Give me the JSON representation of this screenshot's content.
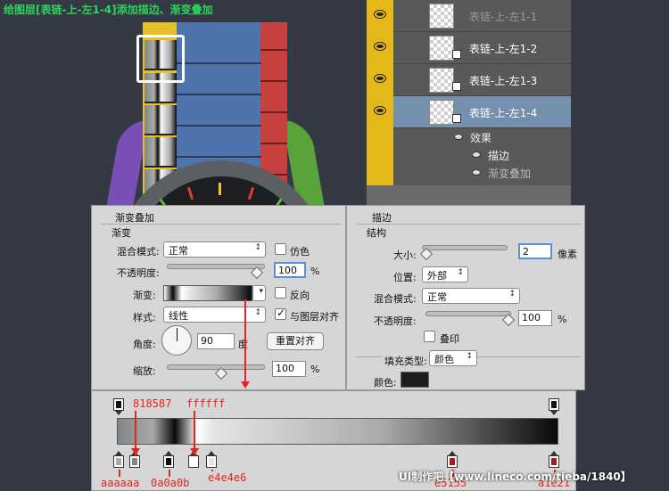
{
  "caption": "给图层[表链-上-左1-4]添加描边、渐变叠加",
  "layers": [
    {
      "name": "表链-上-左1-1",
      "selected": false,
      "dim": true
    },
    {
      "name": "表链-上-左1-2",
      "selected": false,
      "dim": false
    },
    {
      "name": "表链-上-左1-3",
      "selected": false,
      "dim": false
    },
    {
      "name": "表链-上-左1-4",
      "selected": true,
      "dim": false
    }
  ],
  "effects": {
    "header": "效果",
    "stroke": "描边",
    "gradient_overlay": "渐变叠加"
  },
  "gradient_dialog": {
    "title": "渐变叠加",
    "group": "渐变",
    "blend_mode_label": "混合模式:",
    "blend_mode_value": "正常",
    "dither_label": "仿色",
    "opacity_label": "不透明度:",
    "opacity_value": "100",
    "percent": "%",
    "gradient_label": "渐变:",
    "reverse_label": "反向",
    "style_label": "样式:",
    "style_value": "线性",
    "align_label": "与图层对齐",
    "angle_label": "角度:",
    "angle_value": "90",
    "degree": "度",
    "reset_button": "重置对齐",
    "scale_label": "缩放:",
    "scale_value": "100"
  },
  "stroke_dialog": {
    "title": "描边",
    "group": "结构",
    "size_label": "大小:",
    "size_value": "2",
    "size_unit": "像素",
    "position_label": "位置:",
    "position_value": "外部",
    "blend_mode_label": "混合模式:",
    "blend_mode_value": "正常",
    "opacity_label": "不透明度:",
    "opacity_value": "100",
    "percent": "%",
    "overprint_label": "叠印",
    "fill_type_label": "填充类型:",
    "fill_type_value": "颜色",
    "color_label": "颜色:"
  },
  "gradient_stops": {
    "annotations": [
      "818587",
      "ffffff",
      "aaaaaa",
      "0a0a0b",
      "e4e4e6",
      "e5155",
      "a1e21"
    ]
  },
  "watermark": "UI制作吧【www.lineco.com/tieba/1840】",
  "colors": {
    "caption": "#2bd65b",
    "annotation_red": "#e52420",
    "layer_selected": "#7590af",
    "eye_column": "#e5b81a"
  }
}
